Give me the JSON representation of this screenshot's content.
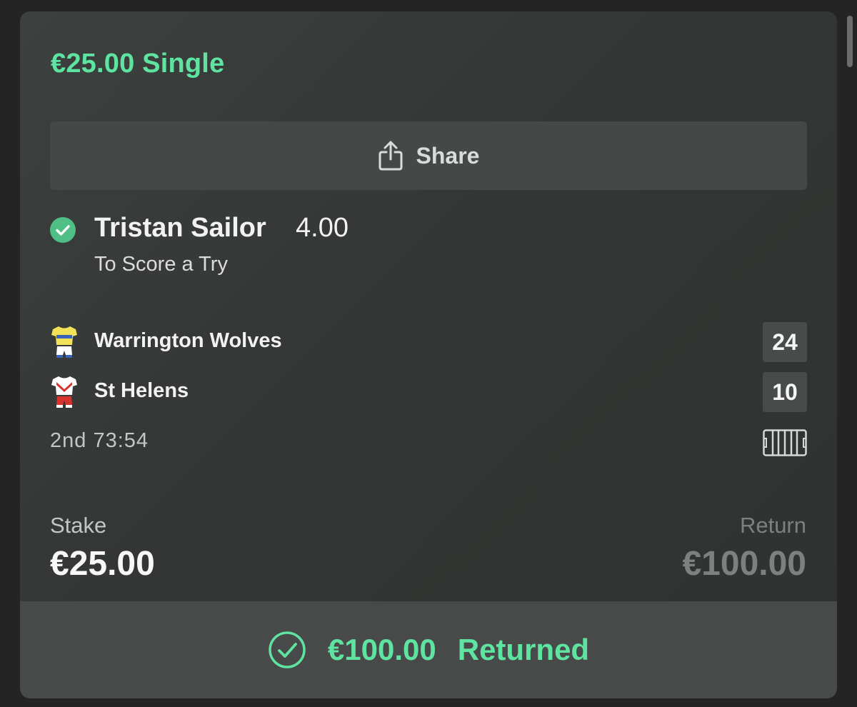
{
  "bet": {
    "title": "€25.00 Single",
    "share_label": "Share",
    "selection": {
      "name": "Tristan Sailor",
      "odds": "4.00",
      "market": "To Score a Try",
      "status_icon": "check-circle-icon"
    },
    "match": {
      "teams": [
        {
          "name": "Warrington Wolves",
          "score": "24",
          "kit_icon": "shirt-yellow-icon"
        },
        {
          "name": "St Helens",
          "score": "10",
          "kit_icon": "shirt-red-white-icon"
        }
      ],
      "period": "2nd",
      "clock": "73:54",
      "pitch_icon": "pitch-icon"
    },
    "stake_label": "Stake",
    "stake_value": "€25.00",
    "return_label": "Return",
    "return_value": "€100.00",
    "footer": {
      "amount": "€100.00",
      "status": "Returned"
    }
  },
  "colors": {
    "accent": "#5fe3a1",
    "card_bg": "#353836",
    "page_bg": "#232423",
    "muted": "#7d807e"
  }
}
